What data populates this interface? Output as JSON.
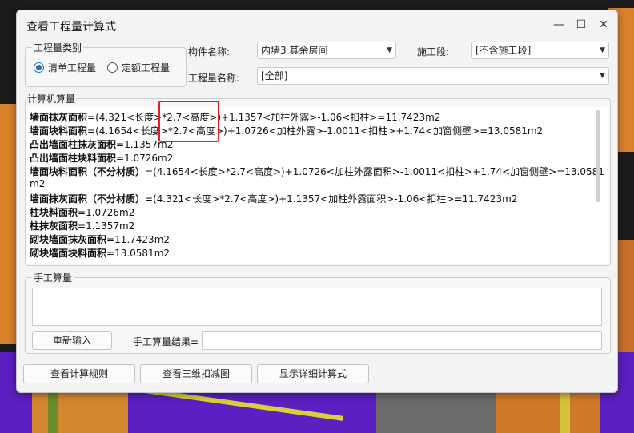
{
  "dialog": {
    "title": "查看工程量计算式"
  },
  "type_group": {
    "legend": "工程量类别",
    "options": [
      {
        "label": "清单工程量",
        "checked": true
      },
      {
        "label": "定额工程量",
        "checked": false
      }
    ]
  },
  "fields": {
    "component_label": "构件名称:",
    "component_value": "内墙3  其余房间",
    "stage_label": "施工段:",
    "stage_value": "[不含施工段]",
    "qty_name_label": "工程量名称:",
    "qty_name_value": "[全部]"
  },
  "computer_calc": {
    "legend": "计算机算量",
    "lines": [
      {
        "name": "墙面抹灰面积",
        "formula": "=(4.321<长度>*2.7<高度>)+1.1357<加柱外露>-1.06<扣柱>=11.7423m2"
      },
      {
        "name": "墙面块料面积",
        "formula": "=(4.1654<长度>*2.7<高度>)+1.0726<加柱外露>-1.0011<扣柱>+1.74<加窗侧壁>=13.0581m2"
      },
      {
        "name": "凸出墙面柱抹灰面积",
        "formula": "=1.1357m2"
      },
      {
        "name": "凸出墙面柱块料面积",
        "formula": "=1.0726m2"
      },
      {
        "name": "墙面块料面积（不分材质）",
        "formula": "=(4.1654<长度>*2.7<高度>)+1.0726<加柱外露面积>-1.0011<扣柱>+1.74<加窗侧壁>=13.0581"
      },
      {
        "name": "",
        "formula": "m2"
      },
      {
        "name": "墙面抹灰面积（不分材质）",
        "formula": "=(4.321<长度>*2.7<高度>)+1.1357<加柱外露面积>-1.06<扣柱>=11.7423m2"
      },
      {
        "name": "柱块料面积",
        "formula": "=1.0726m2"
      },
      {
        "name": "柱抹灰面积",
        "formula": "=1.1357m2"
      },
      {
        "name": "砌块墙面抹灰面积",
        "formula": "=11.7423m2"
      },
      {
        "name": "砌块墙面块料面积",
        "formula": "=13.0581m2"
      }
    ]
  },
  "manual_calc": {
    "legend": "手工算量",
    "reenter_label": "重新输入",
    "result_label": "手工算量结果="
  },
  "bottom_buttons": {
    "rules": "查看计算规则",
    "view3d": "查看三维扣减图",
    "detail": "显示详细计算式"
  },
  "icons": {
    "minimize": "minimize-icon",
    "maximize": "maximize-icon",
    "close": "close-icon",
    "dropdown": "chevron-down-icon"
  }
}
